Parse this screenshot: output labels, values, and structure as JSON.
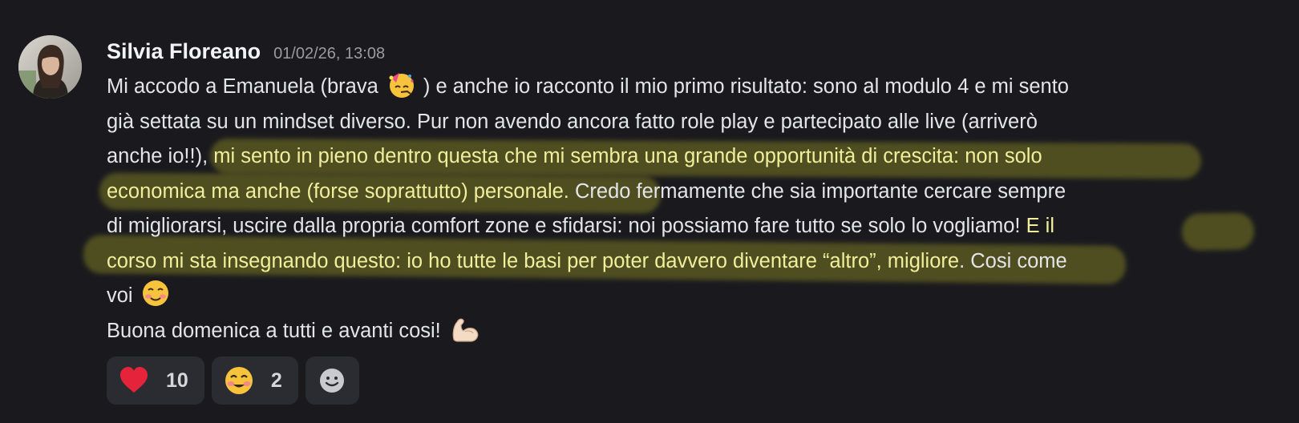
{
  "message": {
    "author": "Silvia Floreano",
    "timestamp": "01/02/26, 13:08",
    "lines": [
      {
        "a": "Mi accodo a Emanuela (brava ",
        "b": " ) e anche io racconto il mio primo risultato: sono al modulo 4 e mi sento"
      },
      {
        "a": "già settata su un mindset diverso. Pur non avendo ancora fatto role play e partecipato alle live (arriverò"
      },
      {
        "a": "anche io!!), ",
        "hl": "mi sento in pieno dentro questa che mi sembra una grande opportunità di crescita: non solo"
      },
      {
        "hl": "economica ma anche (forse soprattutto) personale.",
        "b": " Credo fermamente che sia importante cercare sempre"
      },
      {
        "a": "di migliorarsi, uscire dalla propria comfort zone e sfidarsi: noi possiamo fare tutto se solo lo vogliamo! ",
        "hl": "E il"
      },
      {
        "hl": "corso mi sta insegnando questo: io ho tutte le basi per poter davvero diventare “altro”, migliore",
        "b": ". Cosi come"
      },
      {
        "a": "voi "
      },
      {
        "a": "Buona domenica a tutti e avanti cosi! "
      }
    ],
    "emojis": {
      "party": "partying-face-emoji",
      "blush": "smiling-face-emoji",
      "muscle": "flexed-biceps-emoji"
    }
  },
  "reactions": [
    {
      "emoji": "red-heart",
      "count": "10"
    },
    {
      "emoji": "smiling-face-with-smiling-eyes",
      "count": "2"
    },
    {
      "emoji": "add-reaction"
    }
  ],
  "colors": {
    "background": "#1a1a1e",
    "text": "#e4e5e8",
    "highlight_text": "#f1ef9c",
    "highlight_marker": "#7a7822",
    "reaction_bg": "#2b2c31"
  }
}
